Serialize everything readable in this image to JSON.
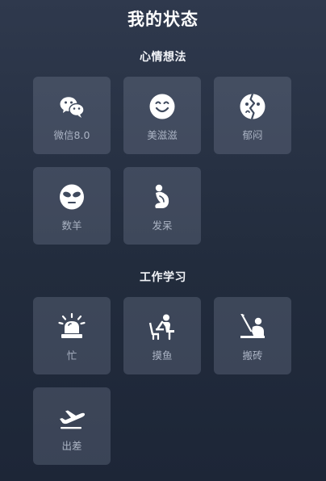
{
  "page": {
    "title": "我的状态"
  },
  "sections": [
    {
      "title": "心情想法",
      "items": [
        {
          "label": "微信8.0",
          "icon": "wechat-icon"
        },
        {
          "label": "美滋滋",
          "icon": "smile-face-icon"
        },
        {
          "label": "郁闷",
          "icon": "cracked-face-icon"
        },
        {
          "label": "数羊",
          "icon": "alien-face-icon"
        },
        {
          "label": "发呆",
          "icon": "crouching-person-icon"
        }
      ]
    },
    {
      "title": "工作学习",
      "items": [
        {
          "label": "忙",
          "icon": "alarm-light-icon"
        },
        {
          "label": "摸鱼",
          "icon": "sitting-person-icon"
        },
        {
          "label": "搬砖",
          "icon": "shovel-worker-icon"
        },
        {
          "label": "出差",
          "icon": "airplane-icon"
        }
      ]
    }
  ]
}
